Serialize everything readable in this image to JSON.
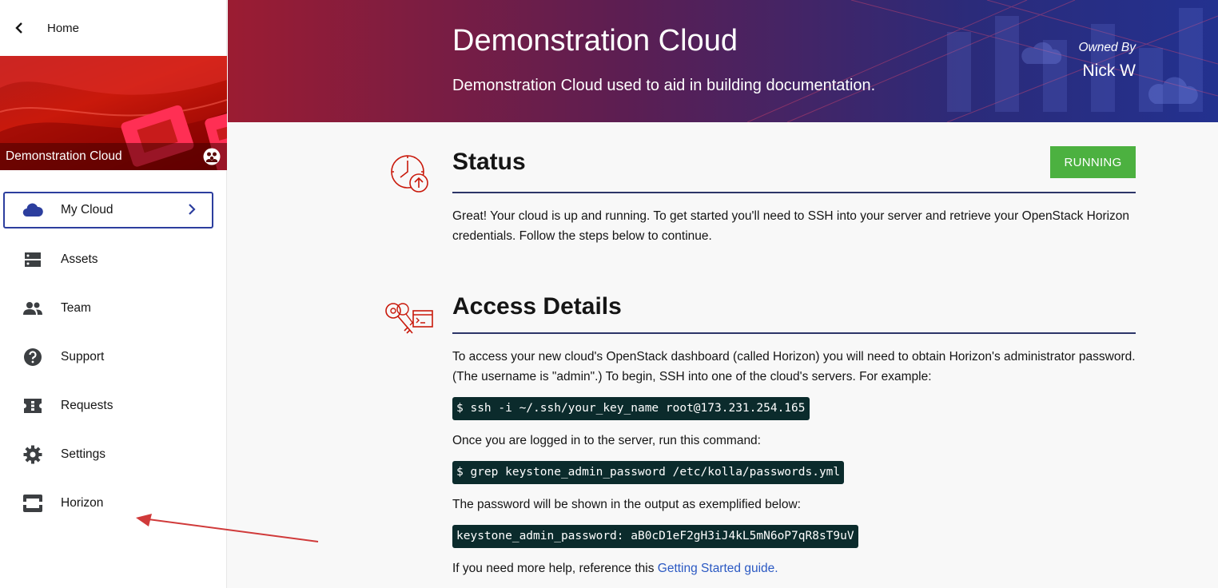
{
  "sidebar": {
    "home_label": "Home",
    "banner_title": "Demonstration Cloud",
    "items": [
      {
        "label": "My Cloud",
        "icon": "cloud-icon",
        "active": true
      },
      {
        "label": "Assets",
        "icon": "server-icon"
      },
      {
        "label": "Team",
        "icon": "people-icon"
      },
      {
        "label": "Support",
        "icon": "help-circle-icon"
      },
      {
        "label": "Requests",
        "icon": "ticket-icon"
      },
      {
        "label": "Settings",
        "icon": "gear-icon"
      },
      {
        "label": "Horizon",
        "icon": "horizon-icon"
      }
    ]
  },
  "header": {
    "title": "Demonstration Cloud",
    "subtitle": "Demonstration Cloud used to aid in building documentation.",
    "owned_by_label": "Owned By",
    "owner_name": "Nick W"
  },
  "status": {
    "title": "Status",
    "badge": "RUNNING",
    "badge_color": "#4cb140",
    "text": "Great! Your cloud is up and running. To get started you'll need to SSH into your server and retrieve your OpenStack Horizon credentials. Follow the steps below to continue."
  },
  "access": {
    "title": "Access Details",
    "intro": "To access your new cloud's OpenStack dashboard (called Horizon) you will need to obtain Horizon's administrator password. (The username is \"admin\".) To begin, SSH into one of the cloud's servers. For example:",
    "ssh_command": "$ ssh -i ~/.ssh/your_key_name root@173.231.254.165",
    "step2": "Once you are logged in to the server, run this command:",
    "grep_command": "$ grep keystone_admin_password /etc/kolla/passwords.yml",
    "step3": "The password will be shown in the output as exemplified below:",
    "password_example": "keystone_admin_password: aB0cD1eF2gH3iJ4kL5mN6oP7qR8sT9uV",
    "help_prefix": "If you need more help, reference this ",
    "help_link": "Getting Started guide."
  },
  "colors": {
    "accent_red": "#c9190b",
    "nav_active_border": "#2c3e9e",
    "code_bg": "#0b2b2c",
    "link": "#2b59c3",
    "annotation_arrow": "#d03a3a"
  }
}
